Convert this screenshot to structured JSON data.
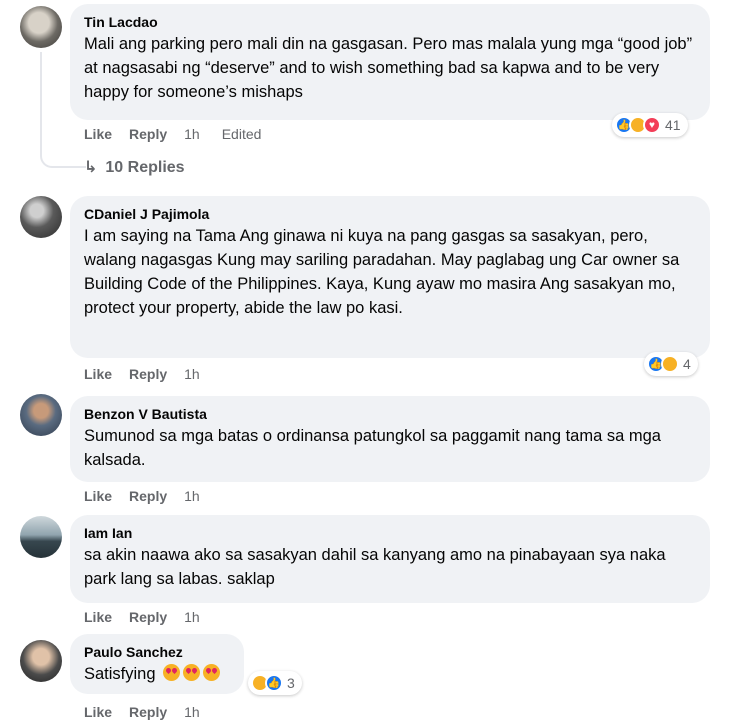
{
  "comments": [
    {
      "author": "Tin Lacdao",
      "text": "Mali ang parking pero mali din na gasgasan. Pero mas malala yung mga “good job” at nagsasabi ng “deserve” and to wish something bad sa kapwa and to be very happy for someone’s mishaps",
      "like": "Like",
      "reply": "Reply",
      "time": "1h",
      "edited": "Edited",
      "reaction_count": "41",
      "replies_label": "10 Replies"
    },
    {
      "author": "CDaniel J Pajimola",
      "text": "I am saying na Tama Ang ginawa ni kuya na pang gasgas sa sasakyan, pero, walang nagasgas Kung may sariling paradahan. May paglabag ung Car owner sa Building Code of the Philippines. Kaya, Kung ayaw mo masira Ang sasakyan mo, protect your property, abide the law po kasi.",
      "like": "Like",
      "reply": "Reply",
      "time": "1h",
      "reaction_count": "4"
    },
    {
      "author": "Benzon V Bautista",
      "text": "Sumunod sa mga batas o ordinansa patungkol sa paggamit nang tama sa mga kalsada.",
      "like": "Like",
      "reply": "Reply",
      "time": "1h"
    },
    {
      "author": "Iam Ian",
      "text": "sa akin naawa ako sa sasakyan dahil sa kanyang amo na pinabayaan sya naka park lang sa labas. saklap",
      "like": "Like",
      "reply": "Reply",
      "time": "1h"
    },
    {
      "author": "Paulo Sanchez",
      "text": "Satisfying",
      "like": "Like",
      "reply": "Reply",
      "time": "1h",
      "reaction_count": "3"
    }
  ],
  "icons": {
    "like": "thumbs-up-icon",
    "haha": "laughing-face-icon",
    "love": "heart-icon",
    "reply_arrow": "reply-arrow-icon",
    "inline_emoji": "heart-eyes-emoji-icon"
  },
  "colors": {
    "bubble": "#f0f2f5",
    "secondary_text": "#65676b",
    "like_blue": "#1877f2",
    "haha_yellow": "#f7b125",
    "love_red": "#f33e58"
  }
}
